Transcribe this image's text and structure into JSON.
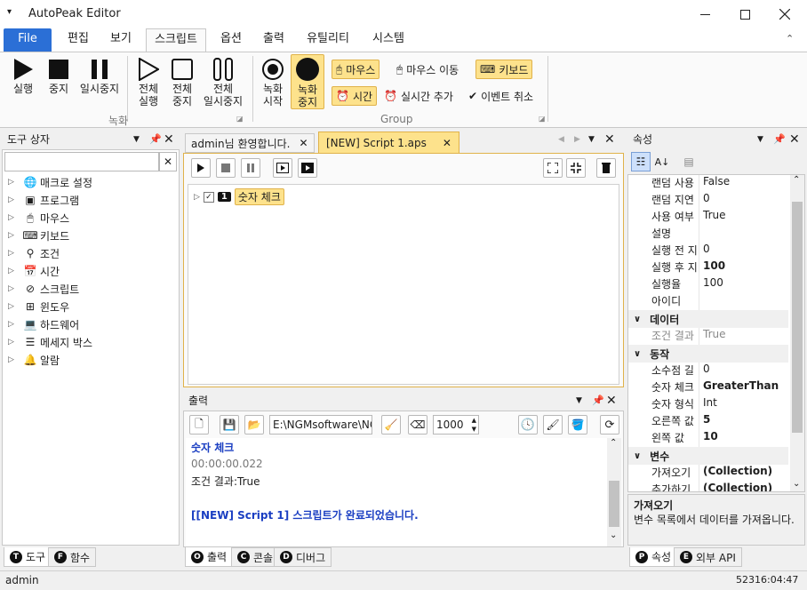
{
  "app": {
    "title": "AutoPeak Editor"
  },
  "ribbon_tabs": [
    "File",
    "편집",
    "보기",
    "스크립트",
    "옵션",
    "출력",
    "유틸리티",
    "시스템"
  ],
  "ribbon": {
    "run": "실행",
    "stop": "중지",
    "pause": "일시중지",
    "run_all_1": "전체",
    "run_all_2": "실행",
    "stop_all_1": "전체",
    "stop_all_2": "중지",
    "pause_all_1": "전체",
    "pause_all_2": "일시중지",
    "group_record": "녹화",
    "rec_start_1": "녹화",
    "rec_start_2": "시작",
    "rec_stop_1": "녹화",
    "rec_stop_2": "중지",
    "mouse": "마우스",
    "mouse_move": "마우스 이동",
    "keyboard": "키보드",
    "time": "시간",
    "realtime_add": "실시간 추가",
    "event_cancel": "이벤트 취소",
    "group_group": "Group"
  },
  "toolbox": {
    "title": "도구 상자",
    "items": [
      "매크로 설정",
      "프로그램",
      "마우스",
      "키보드",
      "조건",
      "시간",
      "스크립트",
      "윈도우",
      "하드웨어",
      "메세지 박스",
      "알람"
    ],
    "tabs": [
      "도구",
      "함수"
    ]
  },
  "doc_tabs": [
    "admin님 환영합니다.",
    "[NEW] Script 1.aps"
  ],
  "script": {
    "node_number": "1",
    "node_label": "숫자 체크"
  },
  "output": {
    "title": "출력",
    "path": "E:\\NGMsoftware\\NG",
    "delay": "1000",
    "lines": [
      "숫자 체크",
      "00:00:00.022",
      "조건 결과:True",
      "",
      "[[NEW] Script 1] 스크립트가 완료되었습니다."
    ],
    "tabs": [
      "출력",
      "콘솔",
      "디버그"
    ]
  },
  "properties": {
    "title": "속성",
    "rows1": [
      {
        "k": "랜덤 사용",
        "v": "False",
        "b": false
      },
      {
        "k": "랜덤 지연",
        "v": "0",
        "b": false
      },
      {
        "k": "사용 여부",
        "v": "True",
        "b": false
      },
      {
        "k": "설명",
        "v": "",
        "b": false
      },
      {
        "k": "실행 전 지",
        "v": "0",
        "b": false
      },
      {
        "k": "실행 후 지",
        "v": "100",
        "b": true
      },
      {
        "k": "실행율",
        "v": "100",
        "b": false
      },
      {
        "k": "아이디",
        "v": "",
        "b": false
      }
    ],
    "cat_data": "데이터",
    "rows2": [
      {
        "k": "조건 결과",
        "v": "True",
        "b": false
      }
    ],
    "cat_action": "동작",
    "rows3": [
      {
        "k": "소수점 길",
        "v": "0",
        "b": false
      },
      {
        "k": "숫자 체크",
        "v": "GreaterThan",
        "b": true
      },
      {
        "k": "숫자 형식",
        "v": "Int",
        "b": false
      },
      {
        "k": "오른쪽 값",
        "v": "5",
        "b": true
      },
      {
        "k": "왼쪽 값",
        "v": "10",
        "b": true
      }
    ],
    "cat_vars": "변수",
    "rows4": [
      {
        "k": "가져오기",
        "v": "(Collection)",
        "b": true
      },
      {
        "k": "추가하기",
        "v": "(Collection)",
        "b": true
      }
    ],
    "desc_title": "가져오기",
    "desc_text": "변수 목록에서 데이터를 가져옵니다.",
    "tabs": [
      "속성",
      "외부 API"
    ]
  },
  "status": {
    "user": "admin",
    "clock": "52316:04:47"
  }
}
